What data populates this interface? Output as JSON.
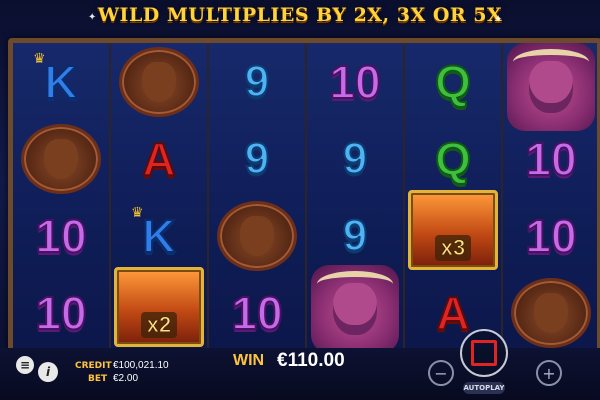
{
  "banner": {
    "title": "WILD MULTIPLIES BY 2X, 3X OR 5X"
  },
  "reels": [
    [
      "K",
      "moose",
      "10",
      "10"
    ],
    [
      "moose",
      "A",
      "K",
      "wild_x2"
    ],
    [
      "9",
      "9",
      "moose",
      "10"
    ],
    [
      "10",
      "9",
      "9",
      "buffalo"
    ],
    [
      "Q",
      "Q",
      "wild_x3",
      "A"
    ],
    [
      "buffalo",
      "10",
      "10",
      "moose"
    ]
  ],
  "multipliers": {
    "x2": "x2",
    "x3": "x3"
  },
  "symbols_text": {
    "ten": "10",
    "nine": "9",
    "a": "A",
    "k": "K",
    "q": "Q"
  },
  "footer": {
    "credit_label": "CREDIT",
    "credit_value": "€100,021.10",
    "bet_label": "BET",
    "bet_value": "€2.00",
    "win_label": "WIN",
    "win_value": "€110.00",
    "minus": "−",
    "plus": "+",
    "autoplay_label": "AUTOPLAY"
  },
  "icons": [
    "menu-icon",
    "info-icon",
    "minus-icon",
    "plus-icon",
    "spin-icon",
    "crown-icon"
  ],
  "colors": {
    "gold": "#ffc53a",
    "purple_10": "#c46be8",
    "blue_9": "#4fb3f3",
    "red_A": "#e02424",
    "green_Q": "#3fbf3f",
    "blue_K": "#2f7ee9"
  }
}
